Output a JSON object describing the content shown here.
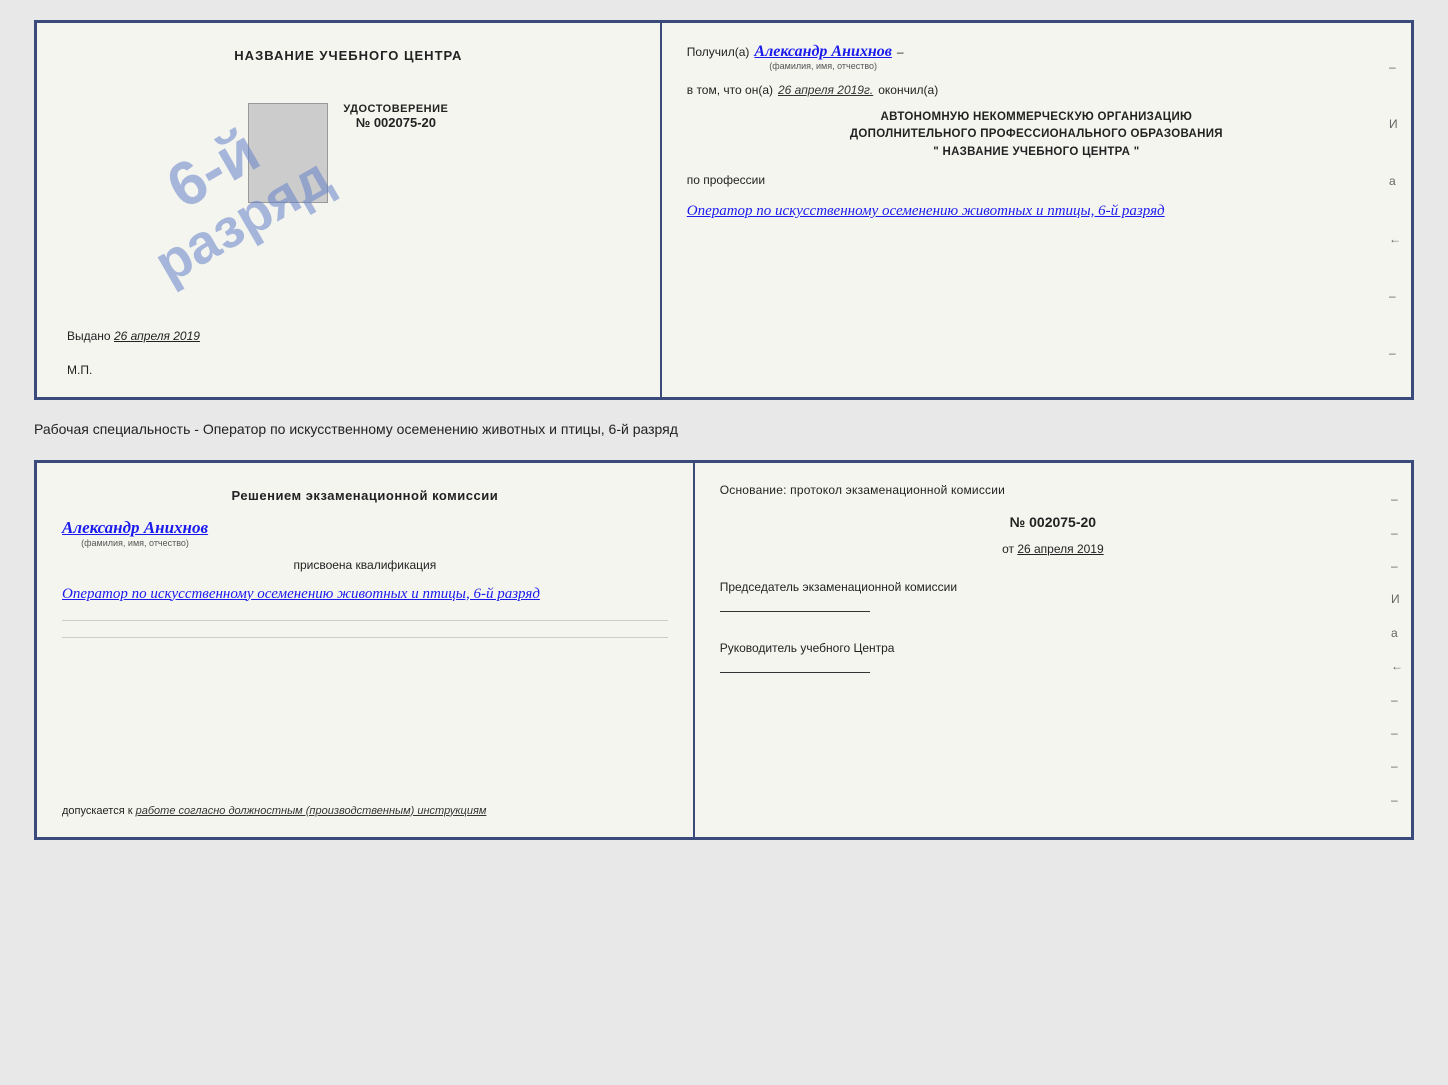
{
  "page": {
    "background": "#e8e8e8"
  },
  "caption": {
    "text": "Рабочая специальность - Оператор по искусственному осеменению животных и птицы, 6-й разряд"
  },
  "top_cert": {
    "left": {
      "title": "НАЗВАНИЕ УЧЕБНОГО ЦЕНТРА",
      "stamp_line1": "6-й",
      "stamp_line2": "разряд",
      "udostoverenie_label": "УДОСТОВЕРЕНИЕ",
      "number": "№ 002075-20",
      "vydano_label": "Выдано",
      "vydano_date": "26 апреля 2019",
      "mp": "М.П."
    },
    "right": {
      "poluchil_label": "Получил(а)",
      "poluchil_name": "Александр Анихнов",
      "fio_subtitle": "(фамилия, имя, отчество)",
      "dash1": "–",
      "v_tom_label": "в том, что он(а)",
      "v_tom_date": "26 апреля 2019г.",
      "okончил_label": "окончил(а)",
      "org_line1": "АВТОНОМНУЮ НЕКОММЕРЧЕСКУЮ ОРГАНИЗАЦИЮ",
      "org_line2": "ДОПОЛНИТЕЛЬНОГО ПРОФЕССИОНАЛЬНОГО ОБРАЗОВАНИЯ",
      "org_line3": "\"  НАЗВАНИЕ УЧЕБНОГО ЦЕНТРА  \"",
      "po_professii": "по профессии",
      "professiya": "Оператор по искусственному осеменению животных и птицы, 6-й разряд",
      "dashes": [
        "–",
        "И",
        "а",
        "←",
        "–",
        "–",
        "–",
        "–"
      ]
    }
  },
  "bottom_cert": {
    "left": {
      "resheniem": "Решением экзаменационной комиссии",
      "name": "Александр Анихнов",
      "fio_subtitle": "(фамилия, имя, отчество)",
      "prisvoena": "присвоена квалификация",
      "kvalif": "Оператор по искусственному осеменению животных и птицы, 6-й разряд",
      "dopuskaetsya_label": "допускается к",
      "dopuskaetsya_value": "работе согласно должностным (производственным) инструкциям"
    },
    "right": {
      "osnovanie": "Основание: протокол экзаменационной комиссии",
      "protocol_number": "№  002075-20",
      "ot_label": "от",
      "ot_date": "26 апреля 2019",
      "chairman_title": "Председатель экзаменационной комиссии",
      "rukovoditel_title": "Руководитель учебного Центра",
      "dashes": [
        "–",
        "–",
        "–",
        "И",
        "а",
        "←",
        "–",
        "–",
        "–",
        "–"
      ]
    }
  }
}
